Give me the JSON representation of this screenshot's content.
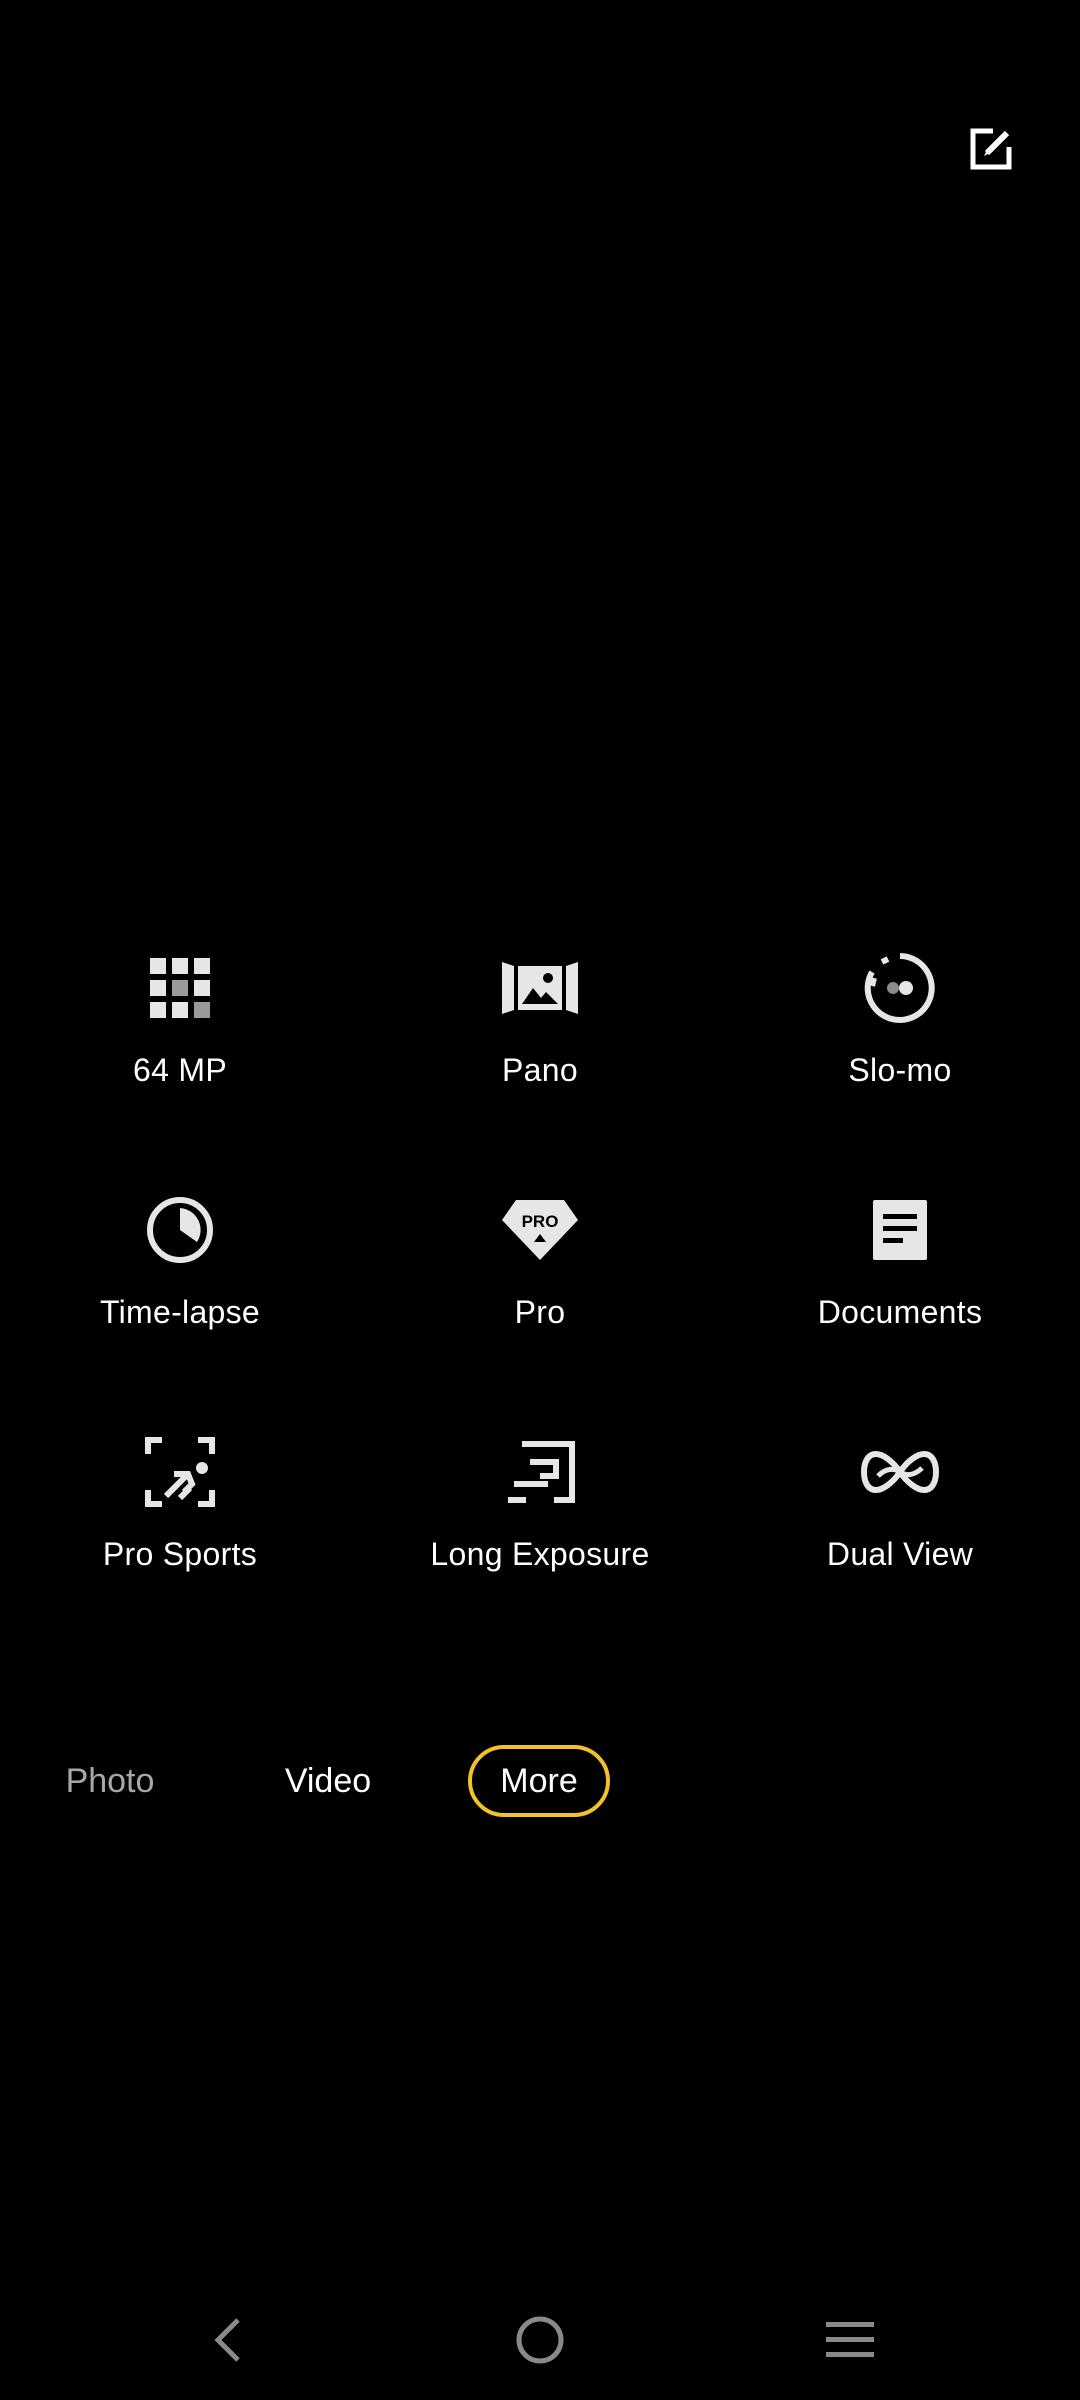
{
  "top_bar": {
    "edit_icon": "edit-icon"
  },
  "modes": [
    {
      "label": "64 MP",
      "icon": "grid-64mp-icon"
    },
    {
      "label": "Pano",
      "icon": "panorama-icon"
    },
    {
      "label": "Slo-mo",
      "icon": "slow-motion-icon"
    },
    {
      "label": "Time-lapse",
      "icon": "time-lapse-icon"
    },
    {
      "label": "Pro",
      "icon": "pro-badge-icon"
    },
    {
      "label": "Documents",
      "icon": "document-icon"
    },
    {
      "label": "Pro Sports",
      "icon": "pro-sports-icon"
    },
    {
      "label": "Long Exposure",
      "icon": "long-exposure-icon"
    },
    {
      "label": "Dual View",
      "icon": "dual-view-icon"
    }
  ],
  "mode_bar": {
    "photo": "Photo",
    "video": "Video",
    "more": "More",
    "selected": "More",
    "accent_color": "#f2c328"
  },
  "nav": {
    "back_icon": "back-icon",
    "home_icon": "home-icon",
    "recents_icon": "recents-icon"
  }
}
